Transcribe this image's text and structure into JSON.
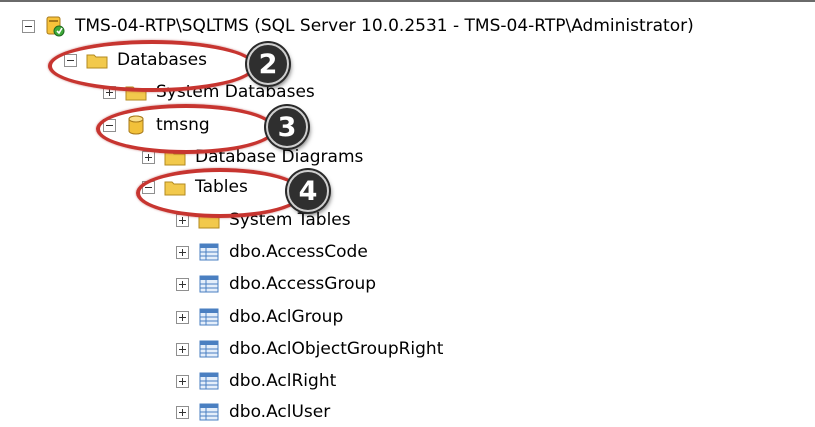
{
  "tree": {
    "server": "TMS-04-RTP\\SQLTMS (SQL Server 10.0.2531 - TMS-04-RTP\\Administrator)",
    "databases": "Databases",
    "system_databases": "System Databases",
    "tmsng": "tmsng",
    "database_diagrams": "Database Diagrams",
    "tables": "Tables",
    "system_tables": "System Tables",
    "table_items": [
      "dbo.AccessCode",
      "dbo.AccessGroup",
      "dbo.AclGroup",
      "dbo.AclObjectGroupRight",
      "dbo.AclRight",
      "dbo.AclUser"
    ]
  },
  "callouts": {
    "databases": "2",
    "tmsng": "3",
    "tables": "4"
  },
  "colors": {
    "highlight_circle": "#c73530",
    "badge_bg": "#2f2f2f",
    "folder": "#f2c94c",
    "table_icon": "#4a7fc1"
  }
}
